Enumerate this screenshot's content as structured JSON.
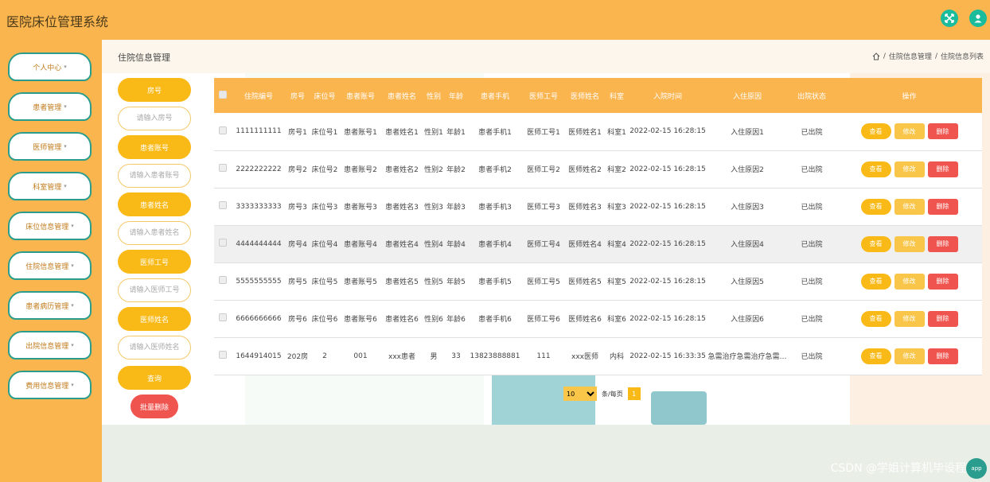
{
  "app": {
    "title": "医院床位管理系统"
  },
  "header_icons": [
    {
      "name": "fullscreen-icon"
    },
    {
      "name": "user-icon"
    }
  ],
  "sidebar": {
    "items": [
      {
        "label": "个人中心"
      },
      {
        "label": "患者管理"
      },
      {
        "label": "医师管理"
      },
      {
        "label": "科室管理"
      },
      {
        "label": "床位信息管理"
      },
      {
        "label": "住院信息管理"
      },
      {
        "label": "患者病历管理"
      },
      {
        "label": "出院信息管理"
      },
      {
        "label": "费用信息管理"
      }
    ]
  },
  "page": {
    "heading": "住院信息管理",
    "breadcrumb": [
      "住院信息管理",
      "住院信息列表"
    ]
  },
  "search": {
    "fields": [
      {
        "label": "房号",
        "placeholder": "请输入房号"
      },
      {
        "label": "患者账号",
        "placeholder": "请输入患者账号"
      },
      {
        "label": "患者姓名",
        "placeholder": "请输入患者姓名"
      },
      {
        "label": "医师工号",
        "placeholder": "请输入医师工号"
      },
      {
        "label": "医师姓名",
        "placeholder": "请输入医师姓名"
      }
    ],
    "query_label": "查询",
    "batch_delete_label": "批量删除"
  },
  "table": {
    "columns": [
      "住院编号",
      "房号",
      "床位号",
      "患者账号",
      "患者姓名",
      "性别",
      "年龄",
      "患者手机",
      "医师工号",
      "医师姓名",
      "科室",
      "入院时间",
      "入住原因",
      "出院状态",
      "操作"
    ],
    "rows": [
      [
        "1111111111",
        "房号1",
        "床位号1",
        "患者账号1",
        "患者姓名1",
        "性别1",
        "年龄1",
        "患者手机1",
        "医师工号1",
        "医师姓名1",
        "科室1",
        "2022-02-15 16:28:15",
        "入住原因1",
        "已出院"
      ],
      [
        "2222222222",
        "房号2",
        "床位号2",
        "患者账号2",
        "患者姓名2",
        "性别2",
        "年龄2",
        "患者手机2",
        "医师工号2",
        "医师姓名2",
        "科室2",
        "2022-02-15 16:28:15",
        "入住原因2",
        "已出院"
      ],
      [
        "3333333333",
        "房号3",
        "床位号3",
        "患者账号3",
        "患者姓名3",
        "性别3",
        "年龄3",
        "患者手机3",
        "医师工号3",
        "医师姓名3",
        "科室3",
        "2022-02-15 16:28:15",
        "入住原因3",
        "已出院"
      ],
      [
        "4444444444",
        "房号4",
        "床位号4",
        "患者账号4",
        "患者姓名4",
        "性别4",
        "年龄4",
        "患者手机4",
        "医师工号4",
        "医师姓名4",
        "科室4",
        "2022-02-15 16:28:15",
        "入住原因4",
        "已出院"
      ],
      [
        "5555555555",
        "房号5",
        "床位号5",
        "患者账号5",
        "患者姓名5",
        "性别5",
        "年龄5",
        "患者手机5",
        "医师工号5",
        "医师姓名5",
        "科室5",
        "2022-02-15 16:28:15",
        "入住原因5",
        "已出院"
      ],
      [
        "6666666666",
        "房号6",
        "床位号6",
        "患者账号6",
        "患者姓名6",
        "性别6",
        "年龄6",
        "患者手机6",
        "医师工号6",
        "医师姓名6",
        "科室6",
        "2022-02-15 16:28:15",
        "入住原因6",
        "已出院"
      ],
      [
        "1644914015",
        "202房",
        "2",
        "001",
        "xxx患者",
        "男",
        "33",
        "13823888881",
        "111",
        "xxx医师",
        "内科",
        "2022-02-15 16:33:35",
        "急需治疗急需治疗急需…",
        "已出院"
      ]
    ],
    "actions": {
      "view": "查看",
      "edit": "修改",
      "delete": "删除"
    }
  },
  "pagination": {
    "page_size": "10",
    "page_size_label": "条/每页",
    "current_page": "1"
  },
  "watermark": "CSDN @学姐计算机毕设程序",
  "float_button": "app"
}
